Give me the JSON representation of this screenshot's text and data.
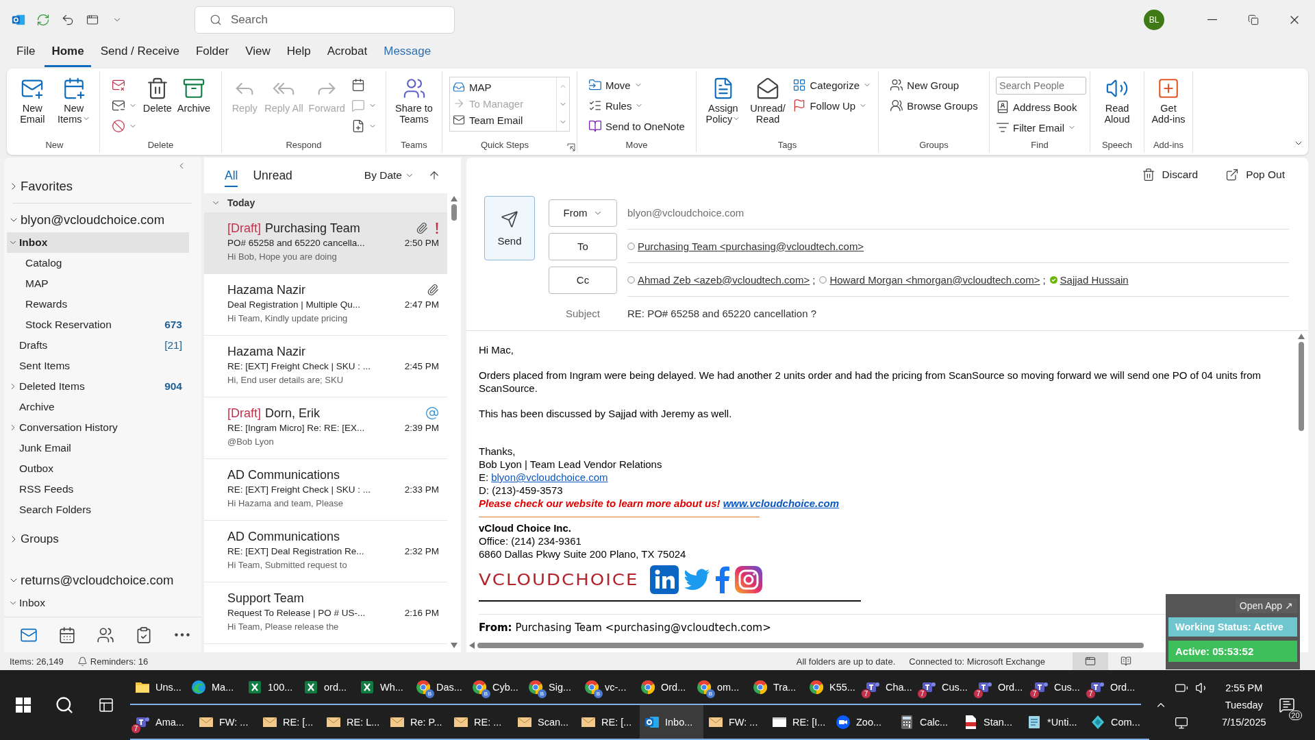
{
  "title_bar": {
    "search_placeholder": "Search",
    "avatar": "BL"
  },
  "menu_tabs": [
    {
      "label": "File",
      "selected": false,
      "kind": "plain"
    },
    {
      "label": "Home",
      "selected": true,
      "kind": "plain"
    },
    {
      "label": "Send / Receive",
      "selected": false,
      "kind": "plain"
    },
    {
      "label": "Folder",
      "selected": false,
      "kind": "plain"
    },
    {
      "label": "View",
      "selected": false,
      "kind": "plain"
    },
    {
      "label": "Help",
      "selected": false,
      "kind": "plain"
    },
    {
      "label": "Acrobat",
      "selected": false,
      "kind": "plain"
    },
    {
      "label": "Message",
      "selected": false,
      "kind": "contextual"
    }
  ],
  "ribbon": {
    "groups": [
      {
        "label": "New",
        "items": [
          {
            "kind": "large",
            "label": "New Email",
            "dropdown": false,
            "disabled": false
          },
          {
            "kind": "large",
            "label": "New Items",
            "dropdown": true,
            "disabled": false
          }
        ]
      },
      {
        "label": "Delete",
        "items": [
          {
            "kind": "column",
            "items": [
              {
                "kind": "icon",
                "dropdown": false,
                "disabled": false
              },
              {
                "kind": "icon",
                "dropdown": true,
                "disabled": false
              },
              {
                "kind": "icon",
                "dropdown": true,
                "disabled": false
              }
            ]
          },
          {
            "kind": "large",
            "label": "Delete",
            "dropdown": false,
            "disabled": false
          },
          {
            "kind": "large",
            "label": "Archive",
            "dropdown": false,
            "disabled": false
          }
        ]
      },
      {
        "label": "Respond",
        "items": [
          {
            "kind": "large",
            "label": "Reply",
            "dropdown": false,
            "disabled": true
          },
          {
            "kind": "large",
            "label": "Reply All",
            "dropdown": false,
            "disabled": true
          },
          {
            "kind": "large",
            "label": "Forward",
            "dropdown": false,
            "disabled": true
          },
          {
            "kind": "column",
            "items": [
              {
                "kind": "icon",
                "dropdown": false,
                "disabled": false
              },
              {
                "kind": "icon",
                "dropdown": true,
                "disabled": true
              },
              {
                "kind": "icon",
                "dropdown": true,
                "disabled": false
              }
            ]
          }
        ]
      },
      {
        "label": "Teams",
        "items": [
          {
            "kind": "large",
            "label": "Share to Teams",
            "dropdown": false,
            "disabled": false
          }
        ]
      },
      {
        "label": "Quick Steps",
        "launcher": true,
        "items": [
          {
            "kind": "quick_steps",
            "items": [
              {
                "label": "MAP",
                "disabled": false
              },
              {
                "label": "To Manager",
                "disabled": true
              },
              {
                "label": "Team Email",
                "disabled": false
              }
            ]
          }
        ]
      },
      {
        "label": "Move",
        "items": [
          {
            "kind": "column",
            "items": [
              {
                "kind": "small",
                "label": "Move",
                "dropdown": true,
                "disabled": false
              },
              {
                "kind": "small",
                "label": "Rules",
                "dropdown": true,
                "disabled": false
              },
              {
                "kind": "small",
                "label": "Send to OneNote",
                "dropdown": false,
                "disabled": false
              }
            ]
          }
        ]
      },
      {
        "label": "Tags",
        "items": [
          {
            "kind": "large",
            "label": "Assign Policy",
            "dropdown": true,
            "disabled": false
          },
          {
            "kind": "large",
            "label": "Unread/ Read",
            "dropdown": false,
            "disabled": false
          },
          {
            "kind": "column",
            "items": [
              {
                "kind": "small",
                "label": "Categorize",
                "dropdown": true,
                "disabled": false
              },
              {
                "kind": "small",
                "label": "Follow Up",
                "dropdown": true,
                "disabled": false
              }
            ]
          }
        ]
      },
      {
        "label": "Groups",
        "items": [
          {
            "kind": "column",
            "items": [
              {
                "kind": "small",
                "label": "New Group",
                "dropdown": false,
                "disabled": false
              },
              {
                "kind": "small",
                "label": "Browse Groups",
                "dropdown": false,
                "disabled": false
              }
            ]
          }
        ]
      },
      {
        "label": "Find",
        "items": [
          {
            "kind": "column",
            "items": [
              {
                "kind": "field",
                "placeholder": "Search People"
              },
              {
                "kind": "small",
                "label": "Address Book",
                "dropdown": false,
                "disabled": false
              },
              {
                "kind": "small",
                "label": "Filter Email",
                "dropdown": true,
                "disabled": false
              }
            ]
          }
        ]
      },
      {
        "label": "Speech",
        "items": [
          {
            "kind": "large",
            "label": "Read Aloud",
            "dropdown": false,
            "disabled": false
          }
        ]
      },
      {
        "label": "Add-ins",
        "items": [
          {
            "kind": "large",
            "label": "Get Add-ins",
            "dropdown": false,
            "disabled": false
          }
        ]
      }
    ]
  },
  "folder_pane": {
    "sections": [
      {
        "kind": "section",
        "label": "Favorites",
        "expanded": false
      },
      {
        "kind": "account",
        "label": "blyon@vcloudchoice.com",
        "expanded": true,
        "folders": [
          {
            "label": "Inbox",
            "selected": true,
            "expanded": true,
            "children": [
              {
                "label": "Catalog",
                "selected": false
              },
              {
                "label": "MAP",
                "selected": false
              },
              {
                "label": "Rewards",
                "selected": false
              },
              {
                "label": "Stock Reservation",
                "selected": false,
                "count": "673",
                "count_bold": true
              }
            ]
          },
          {
            "label": "Drafts",
            "selected": false,
            "count": "[21]",
            "count_bold": false
          },
          {
            "label": "Sent Items",
            "selected": false
          },
          {
            "label": "Deleted Items",
            "selected": false,
            "expanded": false,
            "count": "904",
            "count_bold": true
          },
          {
            "label": "Archive",
            "selected": false
          },
          {
            "label": "Conversation History",
            "selected": false,
            "expanded": false
          },
          {
            "label": "Junk Email",
            "selected": false
          },
          {
            "label": "Outbox",
            "selected": false
          },
          {
            "label": "RSS Feeds",
            "selected": false
          },
          {
            "label": "Search Folders",
            "selected": false
          }
        ]
      },
      {
        "kind": "section",
        "label": "Groups",
        "expanded": false
      },
      {
        "kind": "account",
        "label": "returns@vcloudchoice.com",
        "expanded": true,
        "folders": [
          {
            "label": "Inbox",
            "selected": false,
            "expanded": true
          }
        ]
      }
    ],
    "nav": [
      {
        "selected": true
      },
      {
        "selected": false
      },
      {
        "selected": false
      },
      {
        "selected": false
      },
      {
        "selected": false
      }
    ]
  },
  "message_list": {
    "filters": [
      {
        "label": "All",
        "selected": true
      },
      {
        "label": "Unread",
        "selected": false
      }
    ],
    "sort": "By Date",
    "groups": [
      {
        "label": "Today",
        "expanded": true,
        "messages": [
          {
            "draft_tag": "[Draft]",
            "sender": "Purchasing Team",
            "subject": "PO# 65258 and 65220 cancella...",
            "preview": "Hi Bob, Hope you are doing",
            "time": "2:50 PM",
            "selected": true,
            "attachment": true,
            "important": true,
            "mention": false
          },
          {
            "sender": "Hazama Nazir",
            "subject": "Deal Registration | Multiple Qu...",
            "preview": "Hi Team, Kindly update pricing",
            "time": "2:47 PM",
            "selected": false,
            "attachment": true,
            "important": false,
            "mention": false
          },
          {
            "sender": "Hazama Nazir",
            "subject": "RE: [EXT] Freight Check | SKU : ...",
            "preview": "Hi, End user details are; SKU",
            "time": "2:45 PM",
            "selected": false,
            "attachment": false,
            "important": false,
            "mention": false
          },
          {
            "draft_tag": "[Draft]",
            "sender": "Dorn, Erik",
            "subject": "RE: [Ingram Micro] Re: RE: [EX...",
            "preview": "@Bob Lyon",
            "time": "2:39 PM",
            "selected": false,
            "attachment": false,
            "important": false,
            "mention": true
          },
          {
            "sender": "AD Communications",
            "subject": "RE: [EXT] Freight Check | SKU : ...",
            "preview": "Hi Hazama and team, Please",
            "time": "2:33 PM",
            "selected": false,
            "attachment": false,
            "important": false,
            "mention": false
          },
          {
            "sender": "AD Communications",
            "subject": "RE: [EXT] Deal Registration Re...",
            "preview": "Hi Team, Submitted request to",
            "time": "2:32 PM",
            "selected": false,
            "attachment": false,
            "important": false,
            "mention": false
          },
          {
            "sender": "Support Team",
            "subject": "Request To Release | PO # US-...",
            "preview": "Hi Team, Please release the",
            "time": "2:16 PM",
            "selected": false,
            "attachment": false,
            "important": false,
            "mention": false
          }
        ]
      }
    ]
  },
  "reading_pane": {
    "actions": [
      "Discard",
      "Pop Out"
    ],
    "send_label": "Send",
    "from": {
      "button": "From",
      "value": "blyon@vcloudchoice.com"
    },
    "to": {
      "button": "To",
      "recipients": [
        {
          "name": "Purchasing Team <purchasing@vcloudtech.com>",
          "available": false
        }
      ]
    },
    "cc": {
      "button": "Cc",
      "recipients": [
        {
          "name": "Ahmad Zeb <azeb@vcloudtech.com>",
          "available": false,
          "separator": ";"
        },
        {
          "name": "Howard Morgan <hmorgan@vcloudtech.com>",
          "available": false,
          "separator": ";"
        },
        {
          "name": "Sajjad Hussain",
          "available": true
        }
      ]
    },
    "subject": {
      "label": "Subject",
      "value": "RE: PO# 65258 and 65220 cancellation ?"
    },
    "body": {
      "paragraphs": [
        "Hi Mac,",
        "Orders placed from Ingram were being delayed. We had another 2 units order and had the pricing from ScanSource so moving forward we will send one PO of 04 units from ScanSource.",
        "This has been discussed by Sajjad with Jeremy as well."
      ],
      "signature": [
        {
          "kind": "text",
          "text": "Thanks,"
        },
        {
          "kind": "text",
          "text": "Bob Lyon | Team Lead Vendor Relations"
        },
        {
          "kind": "link",
          "prefix": "E:",
          "link": "blyon@vcloudchoice.com"
        },
        {
          "kind": "text",
          "text": "D: (213)-459-3573"
        },
        {
          "kind": "promo",
          "text": "Please check our website to learn more about us!",
          "link": "www.vcloudchoice.com"
        },
        {
          "kind": "rule"
        },
        {
          "kind": "heading",
          "text": "vCloud Choice Inc."
        },
        {
          "kind": "text",
          "text": "Office: (214) 234-9361"
        },
        {
          "kind": "text",
          "text": "6860 Dallas Pkwy Suite 200 Plano, TX 75024"
        },
        {
          "kind": "logo",
          "text": "VCLOUDCHOICE"
        },
        {
          "kind": "rule_thick"
        }
      ],
      "quoted_header": "**From:** Purchasing Team <purchasing@vcloudtech.com>"
    }
  },
  "status_bar": {
    "items": "Items: 26,149",
    "reminders": "Reminders: 16",
    "sync": "All folders are up to date.",
    "connection": "Connected to: Microsoft Exchange",
    "views": [
      {
        "selected": true
      },
      {
        "selected": false
      }
    ]
  },
  "widget": {
    "open_app": "Open App ↗",
    "status": "Working Status: Active",
    "timer": "Active: 05:53:52"
  },
  "taskbar": {
    "rows": [
      {
        "items": [
          {
            "kind": "folder",
            "label": "Uns...",
            "selected": false
          },
          {
            "kind": "edge",
            "label": "Ma...",
            "selected": false
          },
          {
            "kind": "excel",
            "label": "100...",
            "selected": false
          },
          {
            "kind": "excel",
            "label": "ord...",
            "selected": false
          },
          {
            "kind": "excel",
            "label": "Wh...",
            "selected": false
          },
          {
            "kind": "chrome",
            "label": "Das...",
            "badge": "B",
            "selected": false
          },
          {
            "kind": "chrome",
            "label": "Cyb...",
            "badge": "B",
            "selected": false
          },
          {
            "kind": "chrome",
            "label": "Sig...",
            "badge": "B",
            "selected": false
          },
          {
            "kind": "chrome",
            "label": "vc-...",
            "badge": "B",
            "selected": false
          },
          {
            "kind": "chrome",
            "label": "Ord...",
            "selected": false
          },
          {
            "kind": "chrome",
            "label": "om...",
            "badge": "B",
            "selected": false
          },
          {
            "kind": "chrome",
            "label": "Tra...",
            "selected": false
          },
          {
            "kind": "chrome",
            "label": "K55...",
            "selected": false
          },
          {
            "kind": "teams",
            "label": "Cha...",
            "badge": "7",
            "selected": false
          },
          {
            "kind": "teams",
            "label": "Cus...",
            "badge": "7",
            "selected": false
          },
          {
            "kind": "teams",
            "label": "Ord...",
            "badge": "7",
            "selected": false
          },
          {
            "kind": "teams",
            "label": "Cus...",
            "badge": "7",
            "selected": false
          },
          {
            "kind": "teams",
            "label": "Ord...",
            "badge": "7",
            "selected": false
          }
        ]
      },
      {
        "items": [
          {
            "kind": "teams",
            "label": "Ama...",
            "badge": "7",
            "selected": false
          },
          {
            "kind": "mail",
            "label": "FW: ...",
            "selected": false
          },
          {
            "kind": "mail",
            "label": "RE: [...",
            "selected": false
          },
          {
            "kind": "mail",
            "label": "RE: L...",
            "selected": false
          },
          {
            "kind": "mail",
            "label": "Re: P...",
            "selected": false
          },
          {
            "kind": "mail",
            "label": "RE: ...",
            "selected": false
          },
          {
            "kind": "mail",
            "label": "Scan...",
            "selected": false
          },
          {
            "kind": "mail",
            "label": "RE: [...",
            "selected": false
          },
          {
            "kind": "outlook",
            "label": "Inbo...",
            "selected": true
          },
          {
            "kind": "mail",
            "label": "FW: ...",
            "selected": false
          },
          {
            "kind": "window",
            "label": "RE: [I...",
            "selected": false
          },
          {
            "kind": "zoom",
            "label": "Zoo...",
            "selected": false
          },
          {
            "kind": "calc",
            "label": "Calc...",
            "selected": false
          },
          {
            "kind": "pdf",
            "label": "Stan...",
            "selected": false
          },
          {
            "kind": "notepad",
            "label": "*Unti...",
            "selected": false
          },
          {
            "kind": "app",
            "label": "Com...",
            "selected": false
          }
        ]
      }
    ],
    "tray": {
      "time": "2:55 PM",
      "day": "Tuesday",
      "date": "7/15/2025",
      "notifications": "20"
    }
  }
}
